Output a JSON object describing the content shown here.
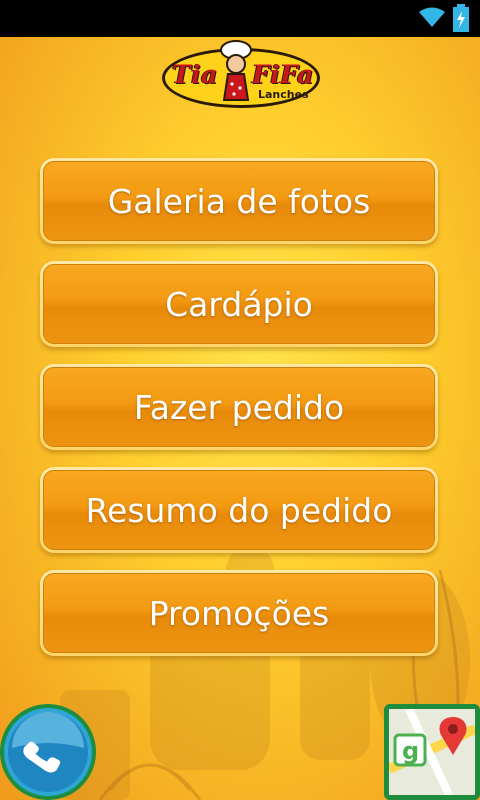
{
  "app": {
    "logo": {
      "name_left": "Tia",
      "name_right": "FiFa",
      "subtitle": "Lanches"
    }
  },
  "menu": {
    "items": [
      {
        "label": "Galeria de fotos"
      },
      {
        "label": "Cardápio"
      },
      {
        "label": "Fazer pedido"
      },
      {
        "label": "Resumo do pedido"
      },
      {
        "label": "Promoções"
      }
    ]
  },
  "actions": {
    "phone_icon": "phone-icon",
    "maps_icon": "google-maps-icon"
  },
  "colors": {
    "button_orange": "#f39a12",
    "background_yellow": "#ffcf2e",
    "phone_blue": "#2ea6d8",
    "green_border": "#1d8d3f"
  }
}
